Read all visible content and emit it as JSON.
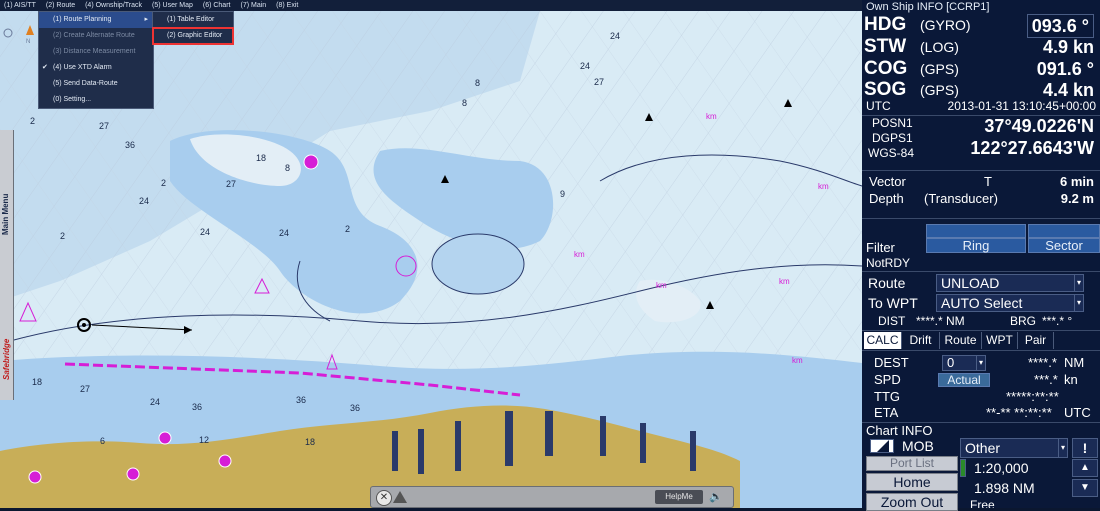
{
  "menubar": [
    "(1) AIS/TT",
    "(2) Route",
    "(4) Ownship/Track",
    "(5) User Map",
    "(6) Chart",
    "(7) Main",
    "(8) Exit"
  ],
  "route_menu": {
    "items": [
      {
        "label": "(1) Route Planning",
        "state": "selected",
        "submenu": true
      },
      {
        "label": "(2) Create Alternate Route",
        "state": "disabled"
      },
      {
        "label": "(3) Distance Measurement",
        "state": "disabled"
      },
      {
        "label": "(4) Use XTD Alarm",
        "state": "checked"
      },
      {
        "label": "(5) Send Data-Route",
        "state": "normal"
      },
      {
        "label": "(0) Setting...",
        "state": "normal"
      }
    ]
  },
  "route_planning_submenu": {
    "items": [
      {
        "label": "(1) Table Editor"
      },
      {
        "label": "(2) Graphic Editor",
        "highlighted": true
      }
    ]
  },
  "main_menu_tab": {
    "label": "Main Menu",
    "brand": "Safebridge"
  },
  "help_bar": {
    "help_label": "HelpMe"
  },
  "panel": {
    "title": "Own Ship INFO [CCRP1]",
    "hdg": {
      "label": "HDG",
      "source": "(GYRO)",
      "value": "093.6 °"
    },
    "stw": {
      "label": "STW",
      "source": "(LOG)",
      "value": "4.9 kn"
    },
    "cog": {
      "label": "COG",
      "source": "(GPS)",
      "value": "091.6 °"
    },
    "sog": {
      "label": "SOG",
      "source": "(GPS)",
      "value": "4.4 kn"
    },
    "utc": {
      "label": "UTC",
      "value": "2013-01-31 13:10:45+00:00"
    },
    "posn": {
      "label1": "POSN1",
      "label2": "DGPS1",
      "label3": "WGS-84",
      "lat": "37°49.0226'N",
      "lon": "122°27.6643'W"
    },
    "vector": {
      "label": "Vector",
      "mode": "T",
      "value": "6 min"
    },
    "depth": {
      "label": "Depth",
      "source": "(Transducer)",
      "value": "9.2 m"
    },
    "filter": {
      "label": "Filter",
      "ring": "Ring",
      "sector": "Sector",
      "status": "NotRDY"
    },
    "route": {
      "label": "Route",
      "value": "UNLOAD"
    },
    "to_wpt": {
      "label": "To WPT",
      "value": "AUTO Select"
    },
    "dist": {
      "label": "DIST",
      "value": "****.* NM"
    },
    "brg": {
      "label": "BRG",
      "value": "***.* °"
    },
    "tabs": [
      "CALC",
      "Drift",
      "Route",
      "WPT",
      "Pair"
    ],
    "dest": {
      "label": "DEST",
      "value": "0",
      "result": "****.*",
      "unit": "NM"
    },
    "spd": {
      "label": "SPD",
      "mode": "Actual",
      "result": "***.*",
      "unit": "kn"
    },
    "ttg": {
      "label": "TTG",
      "value": "*****:**:**"
    },
    "eta": {
      "label": "ETA",
      "value": "**-** **:**:**",
      "unit": "UTC"
    },
    "chart_info": {
      "label": "Chart INFO",
      "mob": "MOB",
      "layer": "Other",
      "alert": "!"
    },
    "port_list": "Port List",
    "home": "Home",
    "zoom_out": "Zoom Out",
    "scale": "1:20,000",
    "range": "1.898 NM",
    "free": "Free"
  },
  "colors": {
    "land": "#c8ae58",
    "deep_water": "#d9ebf5",
    "shallow_water": "#a8cdee",
    "route_line": "#d61ed6",
    "panel_bg": "#0a1838"
  }
}
